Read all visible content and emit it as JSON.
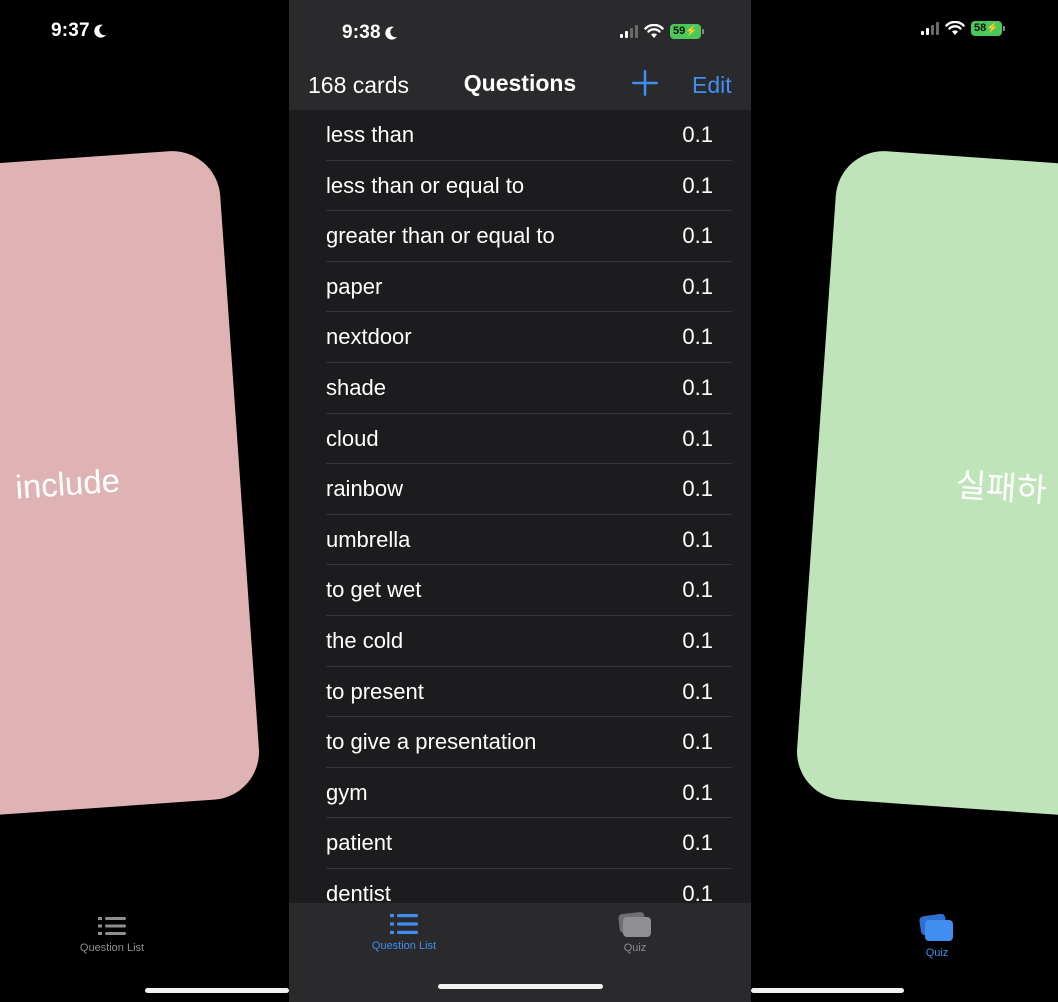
{
  "left_screen": {
    "time": "9:37",
    "card_text": "include",
    "tab_question_list": "Question List"
  },
  "center_screen": {
    "time": "9:38",
    "battery": "59",
    "card_count": "168 cards",
    "title": "Questions",
    "edit_label": "Edit",
    "rows": [
      {
        "label": "less than",
        "value": "0.1"
      },
      {
        "label": "less than or equal to",
        "value": "0.1"
      },
      {
        "label": "greater than or equal to",
        "value": "0.1"
      },
      {
        "label": "paper",
        "value": "0.1"
      },
      {
        "label": "nextdoor",
        "value": "0.1"
      },
      {
        "label": "shade",
        "value": "0.1"
      },
      {
        "label": "cloud",
        "value": "0.1"
      },
      {
        "label": "rainbow",
        "value": "0.1"
      },
      {
        "label": "umbrella",
        "value": "0.1"
      },
      {
        "label": "to get wet",
        "value": "0.1"
      },
      {
        "label": "the cold",
        "value": "0.1"
      },
      {
        "label": "to present",
        "value": "0.1"
      },
      {
        "label": "to give a presentation",
        "value": "0.1"
      },
      {
        "label": "gym",
        "value": "0.1"
      },
      {
        "label": "patient",
        "value": "0.1"
      },
      {
        "label": "dentist",
        "value": "0.1"
      }
    ],
    "tabs": [
      {
        "label": "Question List",
        "active": true
      },
      {
        "label": "Quiz",
        "active": false
      }
    ]
  },
  "right_screen": {
    "battery": "58",
    "card_text": "실패하",
    "tab_quiz": "Quiz"
  },
  "colors": {
    "accent": "#3f8ef0",
    "left_card": "#dfb3b3",
    "right_card": "#bfe4b9",
    "list_bg": "#1c1c1e",
    "bar_bg": "#2a2a2c",
    "inactive_tab": "#8e8e93",
    "battery_green": "#4bc85a"
  },
  "icons": {
    "moon": "moon-icon",
    "signal": "cellular-signal-icon",
    "wifi": "wifi-icon",
    "battery": "battery-charging-icon",
    "add": "plus-icon",
    "question_list": "list-icon",
    "quiz": "cards-stack-icon"
  }
}
